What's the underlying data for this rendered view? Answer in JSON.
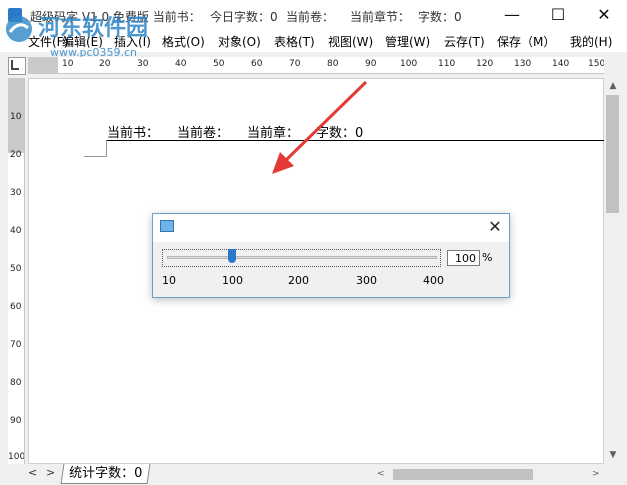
{
  "window": {
    "title": "超级码字 V1.0 免费版  当前书：",
    "today_count": "今日字数：0",
    "current_volume": "当前卷：",
    "current_chapter": "当前章节：",
    "word_count": "字数：0",
    "min_glyph": "—",
    "max_glyph": "☐",
    "close_glyph": "✕"
  },
  "watermark": {
    "text": "河东软件园",
    "url": "www.pc0359.cn"
  },
  "menu": [
    {
      "label": "文件(F)"
    },
    {
      "label": "编辑(E)"
    },
    {
      "label": "插入(I)"
    },
    {
      "label": "格式(O)"
    },
    {
      "label": "对象(O)"
    },
    {
      "label": "表格(T)"
    },
    {
      "label": "视图(W)"
    },
    {
      "label": "管理(W)"
    },
    {
      "label": "云存(T)"
    },
    {
      "label": "保存（M）"
    },
    {
      "label": "我的(H)"
    }
  ],
  "hruler": [
    "10",
    "20",
    "30",
    "40",
    "50",
    "60",
    "70",
    "80",
    "90",
    "100",
    "110",
    "120",
    "130",
    "140",
    "150"
  ],
  "vruler": [
    "10",
    "20",
    "30",
    "40",
    "50",
    "60",
    "70",
    "80",
    "90",
    "100"
  ],
  "document": {
    "header_book": "当前书：",
    "header_volume": "当前卷：",
    "header_chapter": "当前章：",
    "header_words": "字数：0"
  },
  "statusbar": {
    "tab_label": "统计字数：0",
    "nav_prev": "<",
    "nav_next": ">",
    "scroll_left": "<",
    "scroll_right": ">"
  },
  "scrollbar": {
    "up": "▲",
    "down": "▼"
  },
  "zoom_dialog": {
    "close_glyph": "✕",
    "scale_labels": [
      "10",
      "100",
      "200",
      "300",
      "400"
    ],
    "value": "100",
    "unit": "%",
    "slider_min": 10,
    "slider_max": 400,
    "slider_value": 100
  },
  "colors": {
    "accent": "#2b79c9",
    "arrow": "#e53935",
    "watermark": "#2f86c8"
  }
}
